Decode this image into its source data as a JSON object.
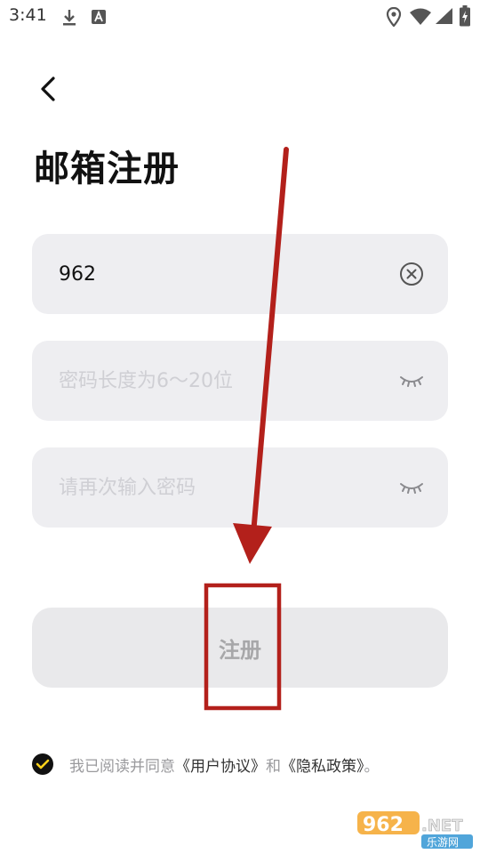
{
  "status_bar": {
    "time": "3:41",
    "icons": [
      "download-icon",
      "text-notification-icon",
      "location-icon",
      "wifi-icon",
      "signal-icon",
      "battery-charging-icon"
    ]
  },
  "back": {
    "icon": "chevron-left-icon"
  },
  "title": "邮箱注册",
  "fields": {
    "email": {
      "value": "962",
      "icon": "clear-circle-icon"
    },
    "password": {
      "placeholder": "密码长度为6～20位",
      "icon": "eye-closed-icon"
    },
    "confirm_password": {
      "placeholder": "请再次输入密码",
      "icon": "eye-closed-icon"
    }
  },
  "register_button": {
    "label": "注册"
  },
  "agreement": {
    "prefix": "我已阅读并同意",
    "user_agreement": "《用户协议》",
    "middle": "和",
    "privacy_policy": "《隐私政策》",
    "suffix": "。",
    "checked": true
  },
  "watermark": {
    "logo_text": "962.NET",
    "sub_text": "乐游网"
  },
  "colors": {
    "field_bg": "#eeeef1",
    "button_bg": "#e9e9eb",
    "button_text": "#a7a7a9",
    "annotation_red": "#b3201b",
    "check_bg": "#111111",
    "check_mark": "#ffd21a"
  }
}
